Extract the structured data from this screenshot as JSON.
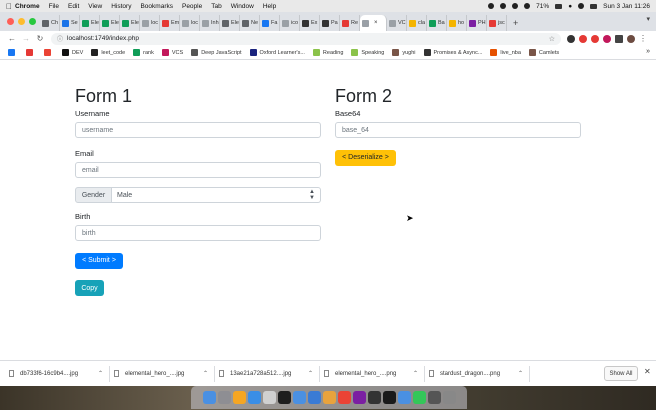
{
  "menubar": {
    "items": [
      "Chrome",
      "File",
      "Edit",
      "View",
      "History",
      "Bookmarks",
      "People",
      "Tab",
      "Window",
      "Help"
    ],
    "battery": "71%",
    "clock": "Sun 3 Jan  11:26"
  },
  "tabs": [
    {
      "label": "Ch",
      "color": "#5f6368"
    },
    {
      "label": "Se",
      "color": "#1a73e8"
    },
    {
      "label": "Ele",
      "color": "#0f9d58"
    },
    {
      "label": "Ele",
      "color": "#0f9d58"
    },
    {
      "label": "Ele",
      "color": "#0f9d58"
    },
    {
      "label": "loc",
      "color": "#9aa0a6"
    },
    {
      "label": "Em",
      "color": "#e53935"
    },
    {
      "label": "loc",
      "color": "#9aa0a6"
    },
    {
      "label": "Inh",
      "color": "#9aa0a6"
    },
    {
      "label": "Ele",
      "color": "#5f6368"
    },
    {
      "label": "Ne",
      "color": "#5f6368"
    },
    {
      "label": "Fa",
      "color": "#1877f2"
    },
    {
      "label": "ico",
      "color": "#9aa0a6"
    },
    {
      "label": "Ex",
      "color": "#333333"
    },
    {
      "label": "Pa",
      "color": "#333333"
    },
    {
      "label": "Re",
      "color": "#e53935"
    },
    {
      "label": "",
      "color": "#9aa0a6",
      "active": true
    },
    {
      "label": "VC",
      "color": "#9aa0a6"
    },
    {
      "label": "cla",
      "color": "#f4b400"
    },
    {
      "label": "Ba",
      "color": "#0f9d58"
    },
    {
      "label": "ho",
      "color": "#f4b400"
    },
    {
      "label": "PH",
      "color": "#7b1fa2"
    },
    {
      "label": "jsc",
      "color": "#e53935"
    }
  ],
  "toolbar": {
    "url": "localhost:1749/index.php"
  },
  "bookmarks": [
    {
      "label": "",
      "color": "#1877f2"
    },
    {
      "label": "",
      "color": "#e53935"
    },
    {
      "label": "",
      "color": "#ea4335"
    },
    {
      "label": "DEV",
      "color": "#111111"
    },
    {
      "label": "leet_code",
      "color": "#222222"
    },
    {
      "label": "rank",
      "color": "#0f9d58"
    },
    {
      "label": "VCS",
      "color": "#c2185b"
    },
    {
      "label": "Deep JavaScript",
      "color": "#555555"
    },
    {
      "label": "Oxford Learner's...",
      "color": "#1a237e"
    },
    {
      "label": "Reading",
      "color": "#8bc34a"
    },
    {
      "label": "Speaking",
      "color": "#8bc34a"
    },
    {
      "label": "yughi",
      "color": "#795548"
    },
    {
      "label": "Promises & Async...",
      "color": "#333333"
    },
    {
      "label": "live_nba",
      "color": "#e65100"
    },
    {
      "label": "Camlets",
      "color": "#795548"
    }
  ],
  "form1": {
    "title": "Form 1",
    "username_label": "Username",
    "username_placeholder": "username",
    "email_label": "Email",
    "email_placeholder": "email",
    "gender_prefix": "Gender",
    "gender_selected": "Male",
    "birth_label": "Birth",
    "birth_placeholder": "birth",
    "submit_label": "< Submit >",
    "copy_label": "Copy"
  },
  "form2": {
    "title": "Form 2",
    "base64_label": "Base64",
    "base64_placeholder": "base_64",
    "deserialize_label": "< Deserialize >"
  },
  "downloads": [
    {
      "name": "db733f6-16c9b4....jpg"
    },
    {
      "name": "elemental_hero_....jpg"
    },
    {
      "name": "13ae21a728a512....jpg"
    },
    {
      "name": "elemental_hero_....png"
    },
    {
      "name": "stardust_dragon....png"
    }
  ],
  "shelf": {
    "show_all": "Show All"
  },
  "dock_colors": [
    "#4a90e2",
    "#8e8e93",
    "#f5a623",
    "#3a8ee6",
    "#d0d0d0",
    "#1e1e1e",
    "#4a90e2",
    "#3a7bd5",
    "#e8a33d",
    "#ea4335",
    "#7b1fa2",
    "#333333",
    "#1a1a1a",
    "#4a90e2",
    "#34c759",
    "#555555",
    "#888888"
  ]
}
